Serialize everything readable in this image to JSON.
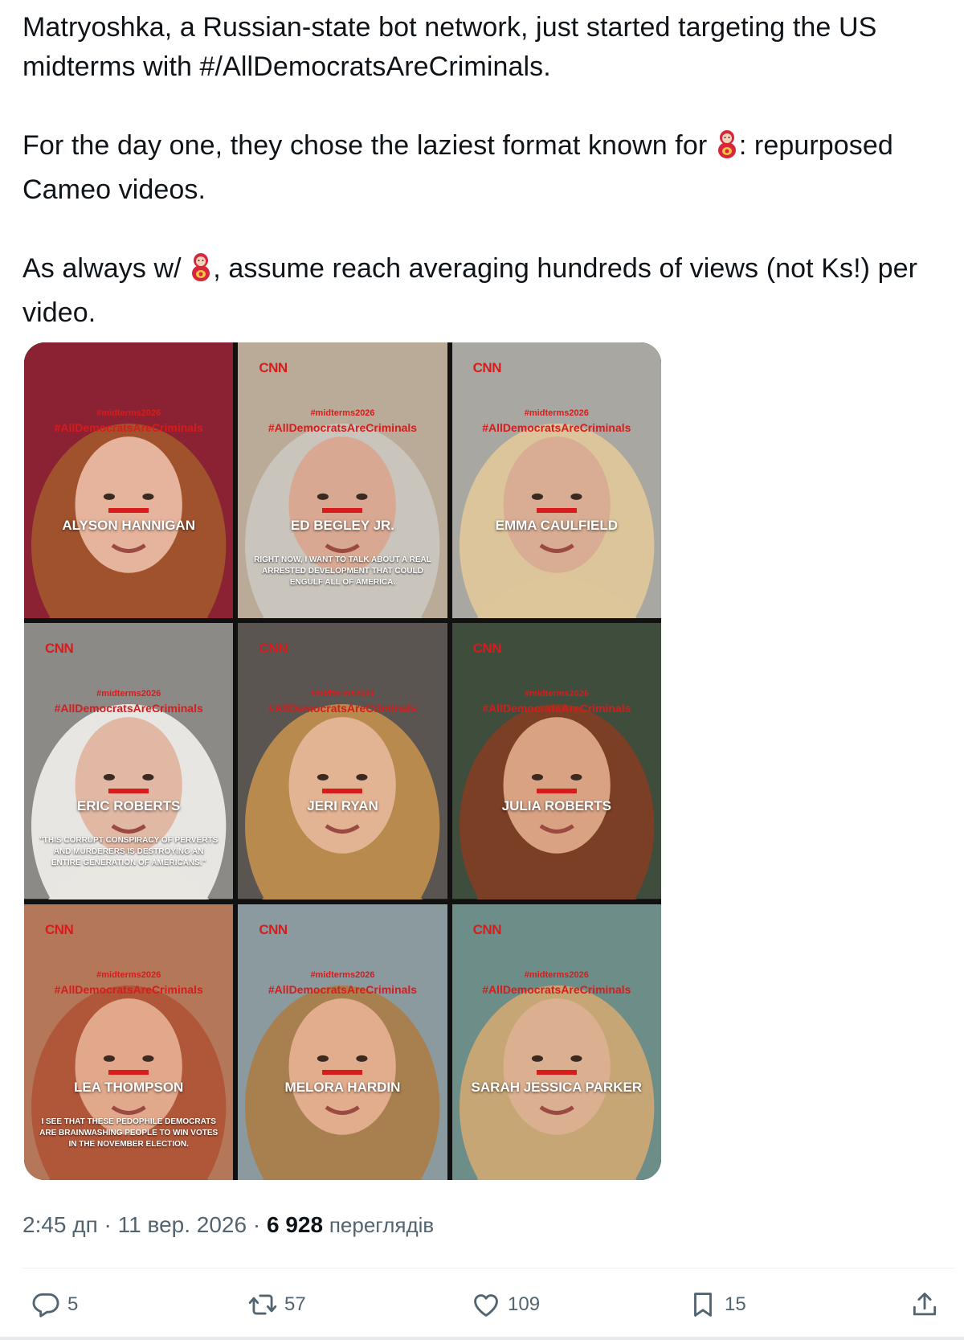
{
  "tweet": {
    "paragraphs": [
      {
        "before": "Matryoshka, a Russian-state bot network, just started targeting the US midterms with #/AllDemocratsAreCriminals.",
        "after": ""
      },
      {
        "before": "For the day one, they chose the laziest format known for ",
        "after": ": repurposed Cameo videos."
      },
      {
        "before": "As always w/ ",
        "after": ", assume reach averaging hundreds of views (not Ks!) per video."
      }
    ],
    "emoji": "matryoshka-doll"
  },
  "media": {
    "tiles": [
      {
        "name": "ALYSON HANNIGAN",
        "cnn": "",
        "hashtag_top": "#midterms2026",
        "hashtag": "#AllDemocratsAreCriminals",
        "quote": "",
        "bg": "#8a2233",
        "skin": "#e6b49c",
        "hair": "#a0522d"
      },
      {
        "name": "ED BEGLEY JR.",
        "cnn": "CNN",
        "hashtag_top": "#midterms2026",
        "hashtag": "#AllDemocratsAreCriminals",
        "quote": "RIGHT NOW, I WANT TO TALK ABOUT A REAL ARRESTED DEVELOPMENT THAT COULD ENGULF ALL OF AMERICA.",
        "bg": "#b9ab97",
        "skin": "#d9a892",
        "hair": "#c9c4bc"
      },
      {
        "name": "EMMA CAULFIELD",
        "cnn": "CNN",
        "hashtag_top": "#midterms2026",
        "hashtag": "#AllDemocratsAreCriminals",
        "quote": "",
        "bg": "#a9a7a2",
        "skin": "#d8ad93",
        "hair": "#dcc59a"
      },
      {
        "name": "ERIC ROBERTS",
        "cnn": "CNN",
        "hashtag_top": "#midterms2026",
        "hashtag": "#AllDemocratsAreCriminals",
        "quote": "\"THIS CORRUPT CONSPIRACY OF PERVERTS AND MURDERERS IS DESTROYING AN ENTIRE GENERATION OF AMERICANS.\"",
        "bg": "#8c8a87",
        "skin": "#e1b8a4",
        "hair": "#e8e6e2"
      },
      {
        "name": "JERI RYAN",
        "cnn": "CNN",
        "hashtag_top": "#midterms2026",
        "hashtag": "#AllDemocratsAreCriminals",
        "quote": "",
        "bg": "#5a5550",
        "skin": "#e3b493",
        "hair": "#b88a4e"
      },
      {
        "name": "JULIA ROBERTS",
        "cnn": "CNN",
        "hashtag_top": "#midterms2026",
        "hashtag": "#AllDemocratsAreCriminals",
        "quote": "",
        "bg": "#3f4d3d",
        "skin": "#d8a283",
        "hair": "#7a3f24"
      },
      {
        "name": "LEA THOMPSON",
        "cnn": "CNN",
        "hashtag_top": "#midterms2026",
        "hashtag": "#AllDemocratsAreCriminals",
        "quote": "I SEE THAT THESE PEDOPHILE DEMOCRATS ARE BRAINWASHING PEOPLE TO WIN VOTES IN THE NOVEMBER ELECTION.",
        "bg": "#b5775a",
        "skin": "#e2a88c",
        "hair": "#b0573a"
      },
      {
        "name": "MELORA HARDIN",
        "cnn": "CNN",
        "hashtag_top": "#midterms2026",
        "hashtag": "#AllDemocratsAreCriminals",
        "quote": "",
        "bg": "#8a9a9f",
        "skin": "#e2ad8d",
        "hair": "#a8804f"
      },
      {
        "name": "SARAH JESSICA PARKER",
        "cnn": "CNN",
        "hashtag_top": "#midterms2026",
        "hashtag": "#AllDemocratsAreCriminals",
        "quote": "",
        "bg": "#6d8e88",
        "skin": "#dbb091",
        "hair": "#c7a676"
      }
    ]
  },
  "meta": {
    "time": "2:45 дп",
    "sep1": " · ",
    "date": "11 вер. 2026",
    "sep2": " · ",
    "views_count": "6 928",
    "views_label": "переглядів"
  },
  "actions": {
    "reply_count": "5",
    "retweet_count": "57",
    "like_count": "109",
    "bookmark_count": "15"
  },
  "colors": {
    "accent_red": "#d81b1b",
    "muted_text": "#536471",
    "text": "#0f1419"
  }
}
